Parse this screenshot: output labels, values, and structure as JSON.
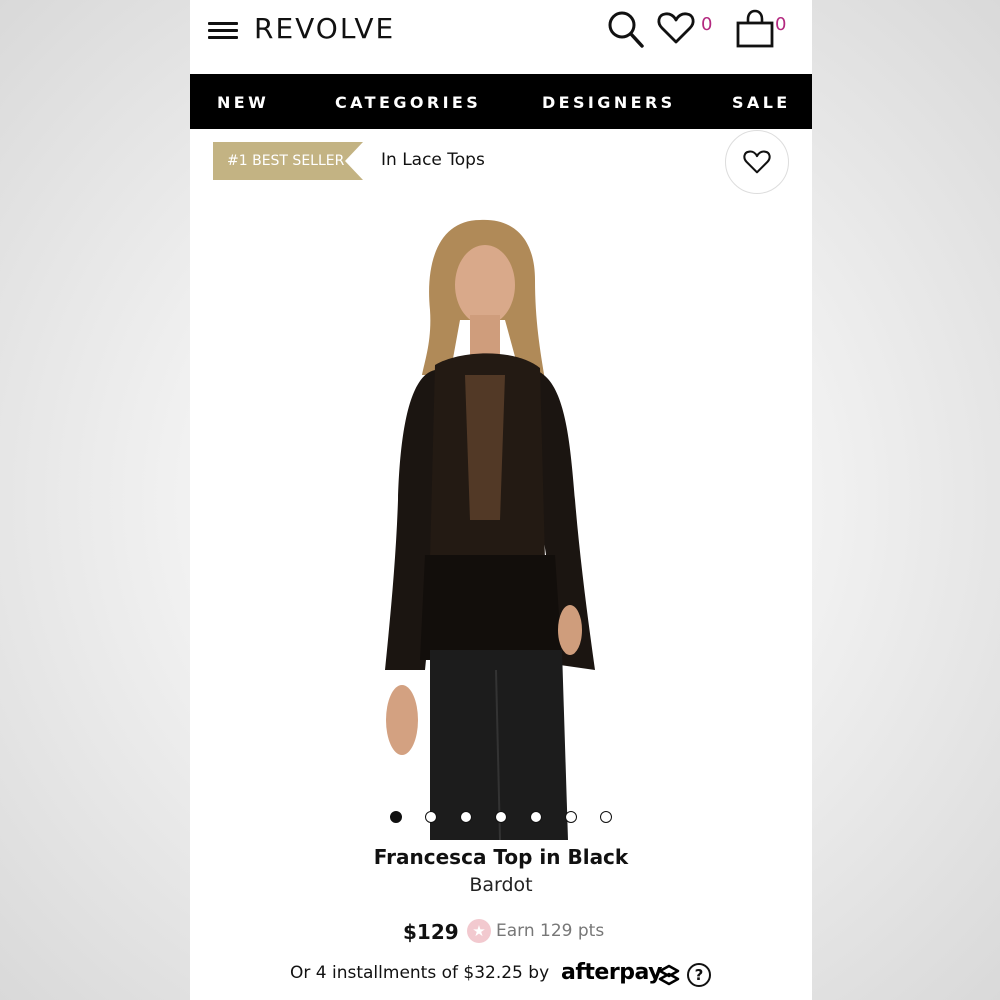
{
  "header": {
    "logo": "REVOLVE",
    "wishlist_count": "0",
    "bag_count": "0",
    "accent_color": "#b3287f"
  },
  "nav": {
    "items": [
      {
        "label": "NEW"
      },
      {
        "label": "CATEGORIES"
      },
      {
        "label": "DESIGNERS"
      },
      {
        "label": "SALE"
      }
    ]
  },
  "badge": {
    "label": "#1 BEST SELLER",
    "color": "#c3b383"
  },
  "category": "In Lace Tops",
  "carousel": {
    "total_images": 7,
    "active_index": 0
  },
  "product": {
    "title": "Francesca Top in Black",
    "designer": "Bardot",
    "price": "$129",
    "points": "Earn 129 pts",
    "installments_text": "Or 4 installments of $32.25 by",
    "afterpay_label": "afterpay",
    "help_label": "?"
  }
}
